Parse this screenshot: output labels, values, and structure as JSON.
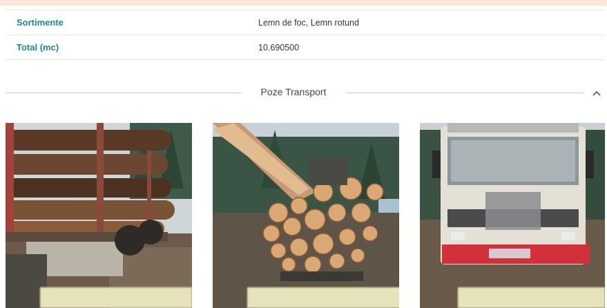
{
  "details": {
    "rows": [
      {
        "label": "Sortimente",
        "value": "Lemn de foc, Lemn rotund"
      },
      {
        "label": "Total (mc)",
        "value": "10.690500"
      }
    ]
  },
  "transport": {
    "title": "Poze Transport",
    "collapse_icon": "chevron-up-icon",
    "photos": [
      {
        "name": "transport-photo-1"
      },
      {
        "name": "transport-photo-2"
      },
      {
        "name": "transport-photo-3"
      }
    ]
  },
  "colors": {
    "label_teal": "#1a8a8a",
    "top_strip": "#fbe6d7"
  }
}
